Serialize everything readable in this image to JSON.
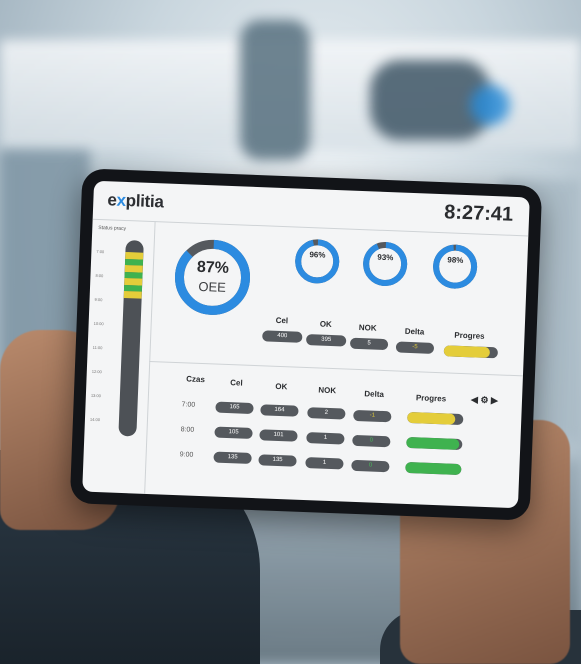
{
  "app": {
    "logo_prefix": "e",
    "logo_mid": "x",
    "logo_rest": "plitia",
    "clock": "8:27:41"
  },
  "sidebar": {
    "title": "Status pracy",
    "ticks": [
      "7:00",
      "8:00",
      "9:00",
      "10:00",
      "11:00",
      "12:00",
      "13:00",
      "14:00"
    ]
  },
  "summary": {
    "oee_percent": "87%",
    "oee_label": "OEE",
    "oee_value": 0.87,
    "gauges": [
      {
        "percent": "96%",
        "value": 0.96
      },
      {
        "percent": "93%",
        "value": 0.93
      },
      {
        "percent": "98%",
        "value": 0.98
      }
    ],
    "headers": {
      "cel": "Cel",
      "ok": "OK",
      "nok": "NOK",
      "delta": "Delta",
      "progres": "Progres"
    },
    "values": {
      "cel": "400",
      "ok": "395",
      "nok": "5",
      "delta": "-5",
      "progress": 0.85
    }
  },
  "table": {
    "headers": {
      "czas": "Czas",
      "cel": "Cel",
      "ok": "OK",
      "nok": "NOK",
      "delta": "Delta",
      "progres": "Progres"
    },
    "nav": {
      "prev": "◀",
      "next": "▶"
    },
    "rows": [
      {
        "czas": "7:00",
        "cel": "165",
        "ok": "164",
        "nok": "2",
        "delta": "-1",
        "progress": 0.85,
        "color": "#e4cd3a"
      },
      {
        "czas": "8:00",
        "cel": "105",
        "ok": "101",
        "nok": "1",
        "delta": "0",
        "progress": 0.95,
        "color": "#3fb24f"
      },
      {
        "czas": "9:00",
        "cel": "135",
        "ok": "135",
        "nok": "1",
        "delta": "0",
        "progress": 1.0,
        "color": "#3fb24f"
      }
    ]
  },
  "colors": {
    "accent_blue": "#2c8be0",
    "donut_track": "#55595e",
    "yellow": "#e4cd3a",
    "green": "#3fb24f"
  }
}
